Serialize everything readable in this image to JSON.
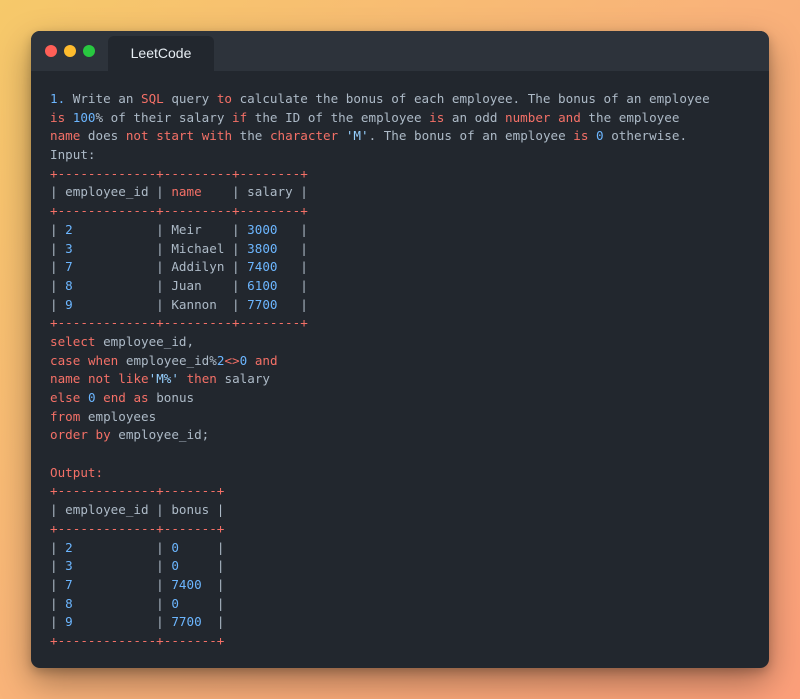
{
  "window": {
    "tab_title": "LeetCode"
  },
  "lines": [
    [
      {
        "t": "1.",
        "c": "blue"
      },
      {
        "t": " Write an "
      },
      {
        "t": "SQL",
        "c": "red-t"
      },
      {
        "t": " query "
      },
      {
        "t": "to",
        "c": "red-t"
      },
      {
        "t": " calculate the bonus of each employee. The bonus of an employee"
      }
    ],
    [
      {
        "t": "is",
        "c": "red-t"
      },
      {
        "t": " "
      },
      {
        "t": "100",
        "c": "blue"
      },
      {
        "t": "% of their salary "
      },
      {
        "t": "if",
        "c": "red-t"
      },
      {
        "t": " the ID of the employee "
      },
      {
        "t": "is",
        "c": "red-t"
      },
      {
        "t": " an odd "
      },
      {
        "t": "number",
        "c": "red-t"
      },
      {
        "t": " "
      },
      {
        "t": "and",
        "c": "red-t"
      },
      {
        "t": " the employee"
      }
    ],
    [
      {
        "t": "name",
        "c": "red-t"
      },
      {
        "t": " does "
      },
      {
        "t": "not",
        "c": "red-t"
      },
      {
        "t": " "
      },
      {
        "t": "start",
        "c": "red-t"
      },
      {
        "t": " "
      },
      {
        "t": "with",
        "c": "red-t"
      },
      {
        "t": " the "
      },
      {
        "t": "character",
        "c": "red-t"
      },
      {
        "t": " "
      },
      {
        "t": "'M'",
        "c": "lite"
      },
      {
        "t": ". The bonus of an employee "
      },
      {
        "t": "is",
        "c": "red-t"
      },
      {
        "t": " "
      },
      {
        "t": "0",
        "c": "blue"
      },
      {
        "t": " otherwise."
      }
    ],
    [
      {
        "t": "Input:"
      }
    ],
    [
      {
        "t": "+-------------+---------+--------+",
        "c": "red-t"
      }
    ],
    [
      {
        "t": "| employee_id | "
      },
      {
        "t": "name",
        "c": "red-t"
      },
      {
        "t": "    | salary |"
      }
    ],
    [
      {
        "t": "+-------------+---------+--------+",
        "c": "red-t"
      }
    ],
    [
      {
        "t": "| "
      },
      {
        "t": "2",
        "c": "blue"
      },
      {
        "t": "           | Meir    | "
      },
      {
        "t": "3000",
        "c": "blue"
      },
      {
        "t": "   |"
      }
    ],
    [
      {
        "t": "| "
      },
      {
        "t": "3",
        "c": "blue"
      },
      {
        "t": "           | Michael | "
      },
      {
        "t": "3800",
        "c": "blue"
      },
      {
        "t": "   |"
      }
    ],
    [
      {
        "t": "| "
      },
      {
        "t": "7",
        "c": "blue"
      },
      {
        "t": "           | Addilyn | "
      },
      {
        "t": "7400",
        "c": "blue"
      },
      {
        "t": "   |"
      }
    ],
    [
      {
        "t": "| "
      },
      {
        "t": "8",
        "c": "blue"
      },
      {
        "t": "           | Juan    | "
      },
      {
        "t": "6100",
        "c": "blue"
      },
      {
        "t": "   |"
      }
    ],
    [
      {
        "t": "| "
      },
      {
        "t": "9",
        "c": "blue"
      },
      {
        "t": "           | Kannon  | "
      },
      {
        "t": "7700",
        "c": "blue"
      },
      {
        "t": "   |"
      }
    ],
    [
      {
        "t": "+-------------+---------+--------+",
        "c": "red-t"
      }
    ],
    [
      {
        "t": "select",
        "c": "red-t"
      },
      {
        "t": " employee_id,"
      }
    ],
    [
      {
        "t": "case",
        "c": "red-t"
      },
      {
        "t": " "
      },
      {
        "t": "when",
        "c": "red-t"
      },
      {
        "t": " employee_id%"
      },
      {
        "t": "2",
        "c": "blue"
      },
      {
        "t": "<>",
        "c": "red-t"
      },
      {
        "t": "0",
        "c": "blue"
      },
      {
        "t": " "
      },
      {
        "t": "and",
        "c": "red-t"
      }
    ],
    [
      {
        "t": "name",
        "c": "red-t"
      },
      {
        "t": " "
      },
      {
        "t": "not",
        "c": "red-t"
      },
      {
        "t": " "
      },
      {
        "t": "like",
        "c": "red-t"
      },
      {
        "t": "'M%'",
        "c": "lite"
      },
      {
        "t": " "
      },
      {
        "t": "then",
        "c": "red-t"
      },
      {
        "t": " salary"
      }
    ],
    [
      {
        "t": "else",
        "c": "red-t"
      },
      {
        "t": " "
      },
      {
        "t": "0",
        "c": "blue"
      },
      {
        "t": " "
      },
      {
        "t": "end",
        "c": "red-t"
      },
      {
        "t": " "
      },
      {
        "t": "as",
        "c": "red-t"
      },
      {
        "t": " bonus"
      }
    ],
    [
      {
        "t": "from",
        "c": "red-t"
      },
      {
        "t": " employees"
      }
    ],
    [
      {
        "t": "order",
        "c": "red-t"
      },
      {
        "t": " "
      },
      {
        "t": "by",
        "c": "red-t"
      },
      {
        "t": " employee_id;"
      }
    ],
    [],
    [
      {
        "t": "Output:",
        "c": "red-t"
      }
    ],
    [
      {
        "t": "+-------------+-------+",
        "c": "red-t"
      }
    ],
    [
      {
        "t": "| employee_id | bonus |"
      }
    ],
    [
      {
        "t": "+-------------+-------+",
        "c": "red-t"
      }
    ],
    [
      {
        "t": "| "
      },
      {
        "t": "2",
        "c": "blue"
      },
      {
        "t": "           | "
      },
      {
        "t": "0",
        "c": "blue"
      },
      {
        "t": "     |"
      }
    ],
    [
      {
        "t": "| "
      },
      {
        "t": "3",
        "c": "blue"
      },
      {
        "t": "           | "
      },
      {
        "t": "0",
        "c": "blue"
      },
      {
        "t": "     |"
      }
    ],
    [
      {
        "t": "| "
      },
      {
        "t": "7",
        "c": "blue"
      },
      {
        "t": "           | "
      },
      {
        "t": "7400",
        "c": "blue"
      },
      {
        "t": "  |"
      }
    ],
    [
      {
        "t": "| "
      },
      {
        "t": "8",
        "c": "blue"
      },
      {
        "t": "           | "
      },
      {
        "t": "0",
        "c": "blue"
      },
      {
        "t": "     |"
      }
    ],
    [
      {
        "t": "| "
      },
      {
        "t": "9",
        "c": "blue"
      },
      {
        "t": "           | "
      },
      {
        "t": "7700",
        "c": "blue"
      },
      {
        "t": "  |"
      }
    ],
    [
      {
        "t": "+-------------+-------+",
        "c": "red-t"
      }
    ]
  ]
}
